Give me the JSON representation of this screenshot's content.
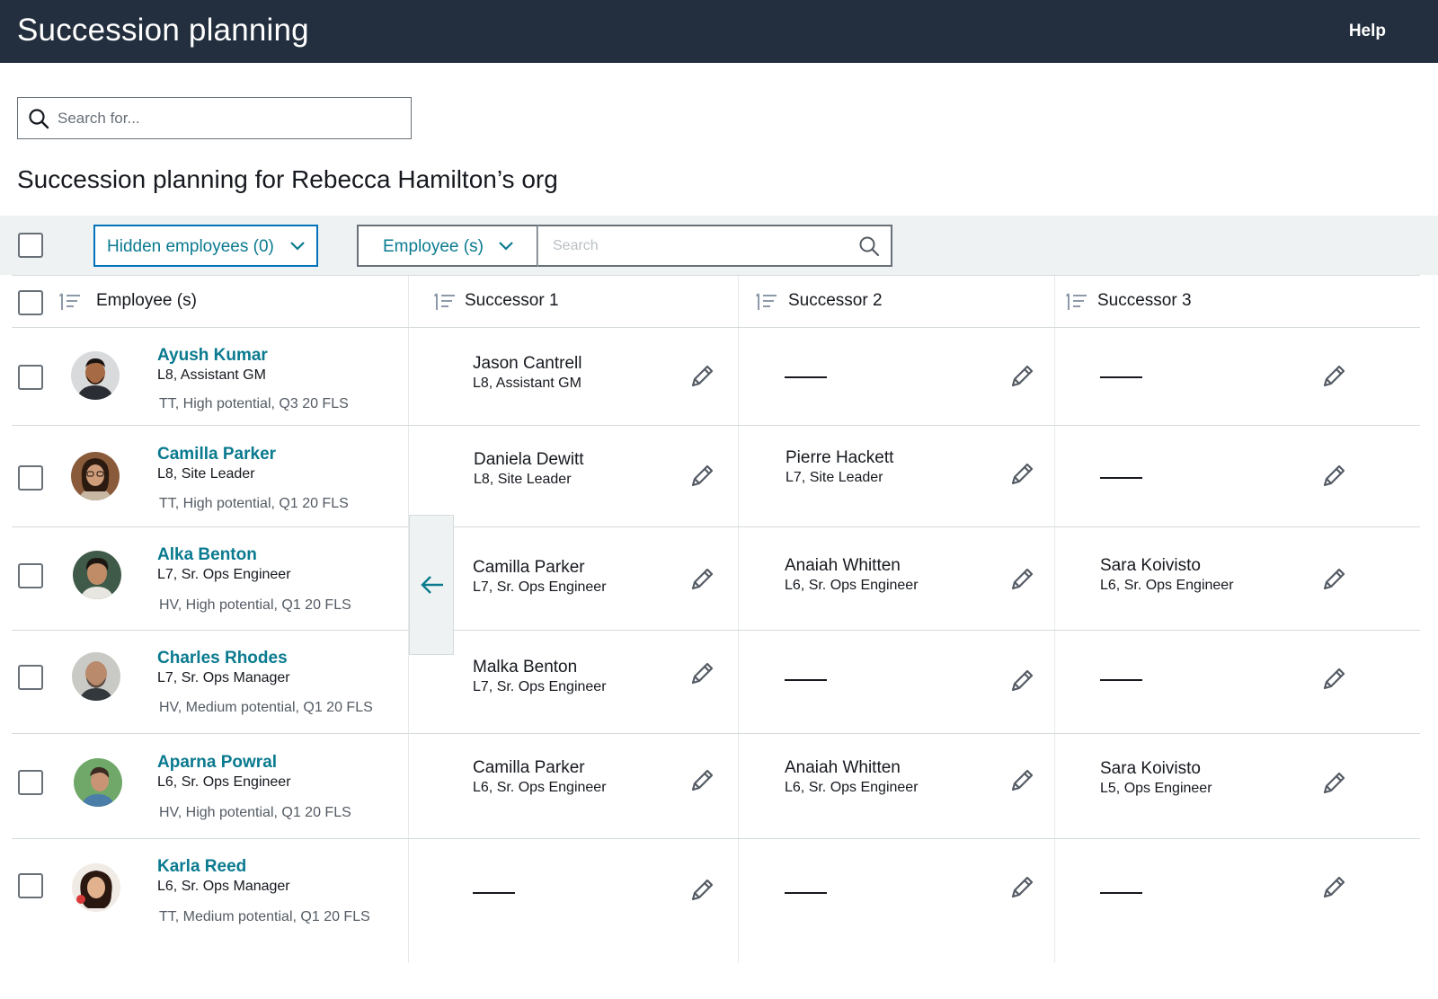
{
  "header": {
    "title": "Succession planning",
    "help": "Help"
  },
  "search": {
    "placeholder": "Search for..."
  },
  "page": {
    "org_title": "Succession planning for Rebecca Hamilton’s org"
  },
  "toolbar": {
    "hidden_employees": "Hidden employees (0)",
    "employee_filter": "Employee (s)",
    "search_placeholder": "Search"
  },
  "columns": [
    "Employee (s)",
    "Successor 1",
    "Successor 2",
    "Successor 3"
  ],
  "rows": [
    {
      "name": "Ayush Kumar",
      "role": "L8, Assistant GM",
      "tags": "TT, High potential, Q3 20 FLS",
      "successors": [
        {
          "name": "Jason Cantrell",
          "role": "L8, Assistant GM"
        },
        null,
        null
      ]
    },
    {
      "name": "Camilla Parker",
      "role": "L8, Site Leader",
      "tags": "TT, High potential, Q1 20 FLS",
      "successors": [
        {
          "name": "Daniela Dewitt",
          "role": "L8, Site Leader"
        },
        {
          "name": "Pierre Hackett",
          "role": "L7, Site Leader"
        },
        null
      ]
    },
    {
      "name": "Alka Benton",
      "role": "L7, Sr. Ops Engineer",
      "tags": "HV, High potential, Q1 20 FLS",
      "successors": [
        {
          "name": "Camilla Parker",
          "role": "L7, Sr. Ops Engineer"
        },
        {
          "name": "Anaiah Whitten",
          "role": "L6, Sr. Ops Engineer"
        },
        {
          "name": "Sara Koivisto",
          "role": "L6, Sr. Ops Engineer"
        }
      ]
    },
    {
      "name": "Charles Rhodes",
      "role": "L7, Sr. Ops Manager",
      "tags": "HV, Medium potential, Q1 20 FLS",
      "successors": [
        {
          "name": "Malka Benton",
          "role": "L7, Sr. Ops Engineer"
        },
        null,
        null
      ]
    },
    {
      "name": "Aparna Powral",
      "role": "L6, Sr. Ops Engineer",
      "tags": "HV, High potential, Q1 20 FLS",
      "successors": [
        {
          "name": "Camilla Parker",
          "role": "L6, Sr. Ops Engineer"
        },
        {
          "name": "Anaiah Whitten",
          "role": "L6, Sr. Ops Engineer"
        },
        {
          "name": "Sara Koivisto",
          "role": "L5, Ops Engineer"
        }
      ]
    },
    {
      "name": "Karla Reed",
      "role": "L6, Sr. Ops Manager",
      "tags": "TT, Medium potential, Q1 20 FLS",
      "successors": [
        null,
        null,
        null
      ]
    }
  ],
  "colors": {
    "header_bg": "#232f3e",
    "link": "#0a7a8f",
    "toolbar_bg": "#eef2f3",
    "accent_border": "#0073bb"
  }
}
